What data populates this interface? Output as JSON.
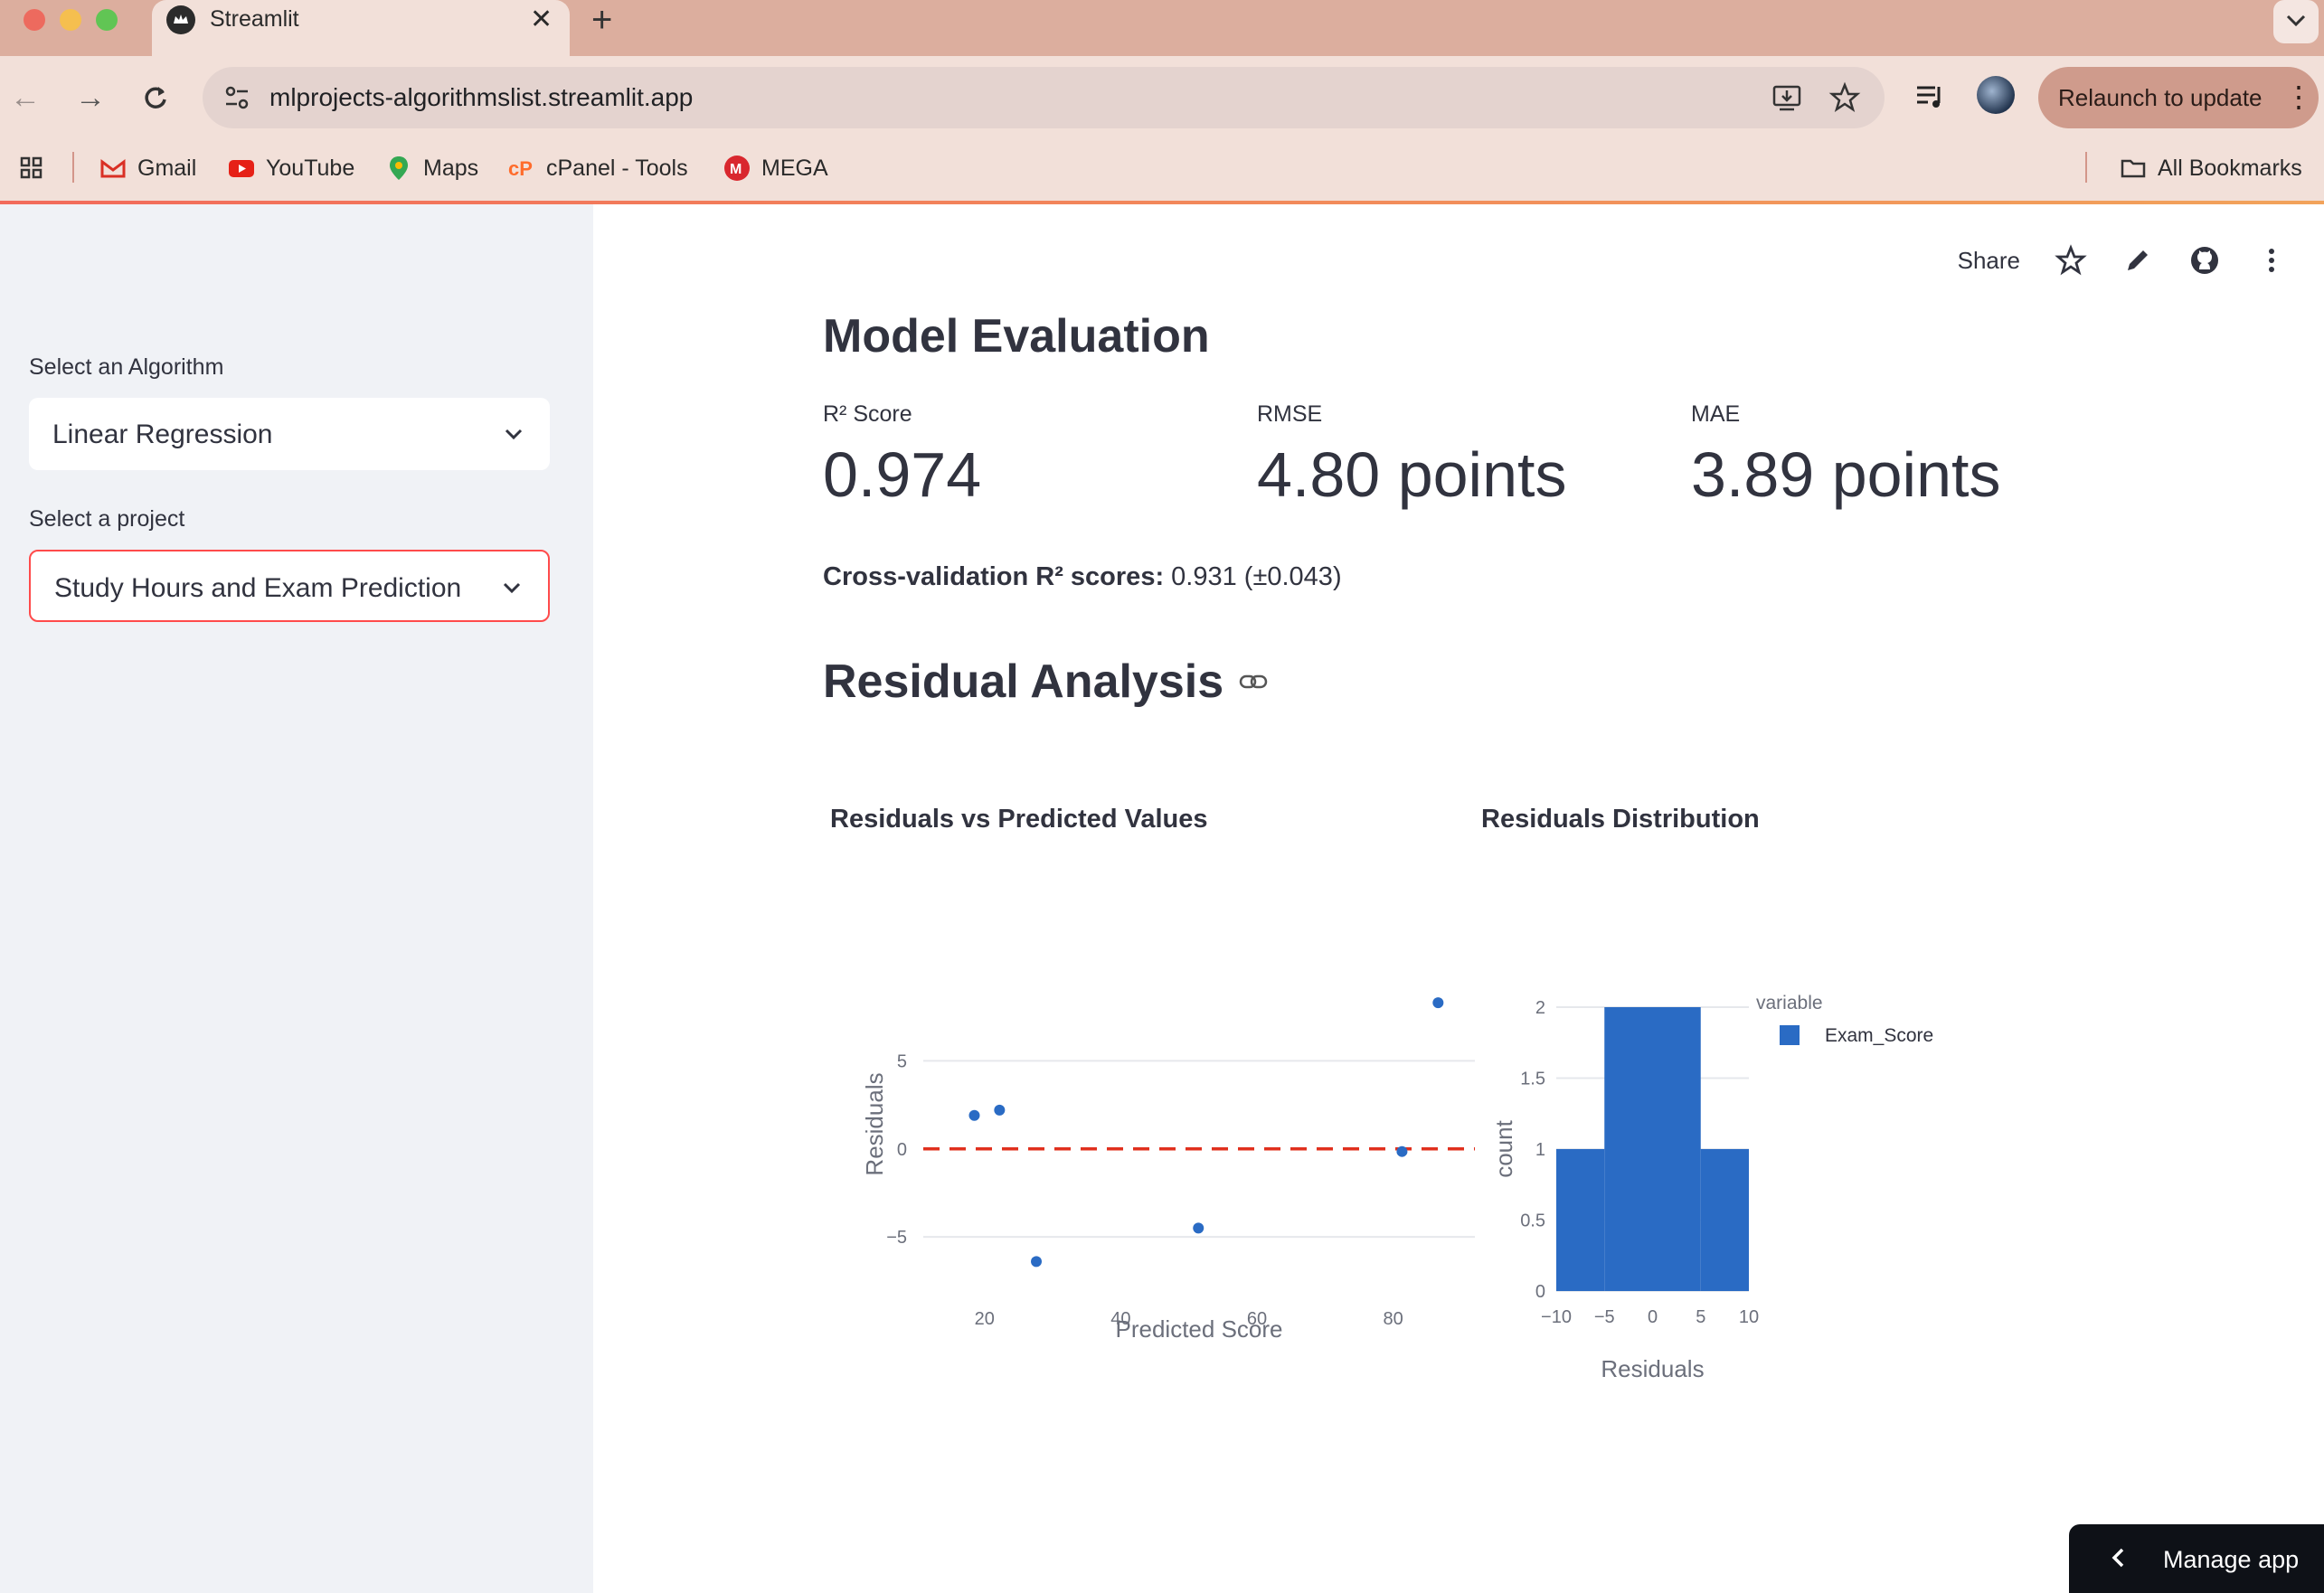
{
  "browser": {
    "tab_title": "Streamlit",
    "url": "mlprojects-algorithmslist.streamlit.app",
    "relaunch_label": "Relaunch to update",
    "bookmarks": [
      "Gmail",
      "YouTube",
      "Maps",
      "cPanel - Tools",
      "MEGA"
    ],
    "all_bookmarks_label": "All Bookmarks"
  },
  "sidebar": {
    "algorithm_label": "Select an Algorithm",
    "algorithm_value": "Linear Regression",
    "project_label": "Select a project",
    "project_value": "Study Hours and Exam Prediction"
  },
  "toolbar": {
    "share_label": "Share"
  },
  "main": {
    "title": "Model Evaluation",
    "metrics": [
      {
        "label": "R² Score",
        "value": "0.974"
      },
      {
        "label": "RMSE",
        "value": "4.80 points"
      },
      {
        "label": "MAE",
        "value": "3.89 points"
      }
    ],
    "cv_label": "Cross-validation R² scores:",
    "cv_value": " 0.931 (±0.043)",
    "residual_title": "Residual Analysis"
  },
  "manage_app_label": "Manage app",
  "colors": {
    "accent": "#ff4b4b",
    "series": "#2a6bc4",
    "sidebar_bg": "#f0f2f6"
  },
  "chart_data": [
    {
      "type": "scatter",
      "title": "Residuals vs Predicted Values",
      "xlabel": "Predicted Score",
      "ylabel": "Residuals",
      "xlim": [
        11,
        92
      ],
      "ylim": [
        -7.2,
        10
      ],
      "xticks": [
        20,
        40,
        60,
        80
      ],
      "yticks": [
        -5,
        0,
        5
      ],
      "points": [
        {
          "x": 18.5,
          "y": 1.9
        },
        {
          "x": 22.2,
          "y": 2.2
        },
        {
          "x": 27.6,
          "y": -6.4
        },
        {
          "x": 51.4,
          "y": -4.5
        },
        {
          "x": 81.3,
          "y": -0.15
        },
        {
          "x": 86.6,
          "y": 8.3
        }
      ],
      "reference_line": {
        "y": 0,
        "style": "dashed",
        "color": "#e0301e"
      },
      "grid": true
    },
    {
      "type": "bar",
      "title": "Residuals Distribution",
      "xlabel": "Residuals",
      "ylabel": "count",
      "bins": [
        {
          "x0": -10,
          "x1": -5,
          "count": 1
        },
        {
          "x0": -5,
          "x1": 5,
          "count": 2
        },
        {
          "x0": 5,
          "x1": 10,
          "count": 1
        }
      ],
      "xlim": [
        -10,
        10
      ],
      "ylim": [
        0,
        2
      ],
      "xticks": [
        "−10",
        "−5",
        "0",
        "5",
        "10"
      ],
      "yticks": [
        "0",
        "0.5",
        "1",
        "1.5",
        "2"
      ],
      "legend": {
        "title": "variable",
        "entries": [
          "Exam_Score"
        ],
        "placement": "top-right"
      },
      "grid": true
    }
  ]
}
